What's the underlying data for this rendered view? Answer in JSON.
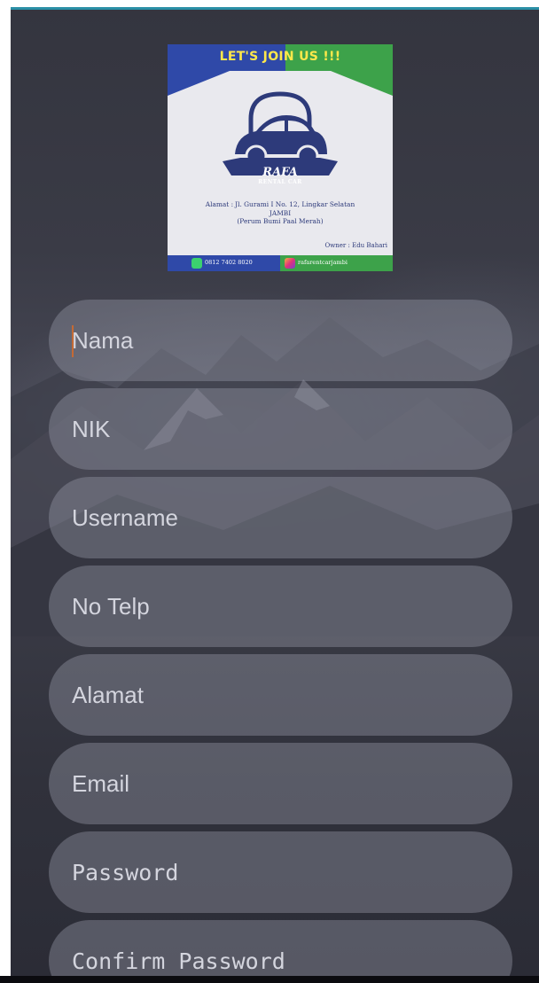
{
  "logo": {
    "banner_text": "LET'S JOIN US !!!",
    "brand_name": "RAFA",
    "brand_subtitle": "RENTAL CAR",
    "address_label": "Alamat :",
    "address_line1": "Jl. Gurami I No. 12, Lingkar Selatan",
    "address_line2": "JAMBI",
    "address_line3": "(Perum Bumi Paal Merah)",
    "owner": "Owner : Edu Bahari",
    "phone": "0812 7402 8020",
    "instagram": "rafarentcarjambi",
    "colors": {
      "blue": "#2f49a8",
      "green": "#3da24a",
      "banner_text": "#ffe84a"
    },
    "icons": [
      "car-icon",
      "whatsapp-icon",
      "instagram-icon"
    ]
  },
  "form": {
    "fields": [
      {
        "name": "Nama",
        "value": "",
        "placeholder": "Nama",
        "focused": true
      },
      {
        "name": "NIK",
        "value": "",
        "placeholder": "NIK"
      },
      {
        "name": "Username",
        "value": "",
        "placeholder": "Username"
      },
      {
        "name": "No Telp",
        "value": "",
        "placeholder": "No Telp"
      },
      {
        "name": "Alamat",
        "value": "",
        "placeholder": "Alamat"
      },
      {
        "name": "Email",
        "value": "",
        "placeholder": "Email"
      },
      {
        "name": "Password",
        "value": "",
        "placeholder": "Password"
      },
      {
        "name": "Confirm Password",
        "value": "",
        "placeholder": "Confirm Password"
      }
    ]
  },
  "theme": {
    "accent": "#2a8fa6",
    "caret": "#c46a34"
  }
}
